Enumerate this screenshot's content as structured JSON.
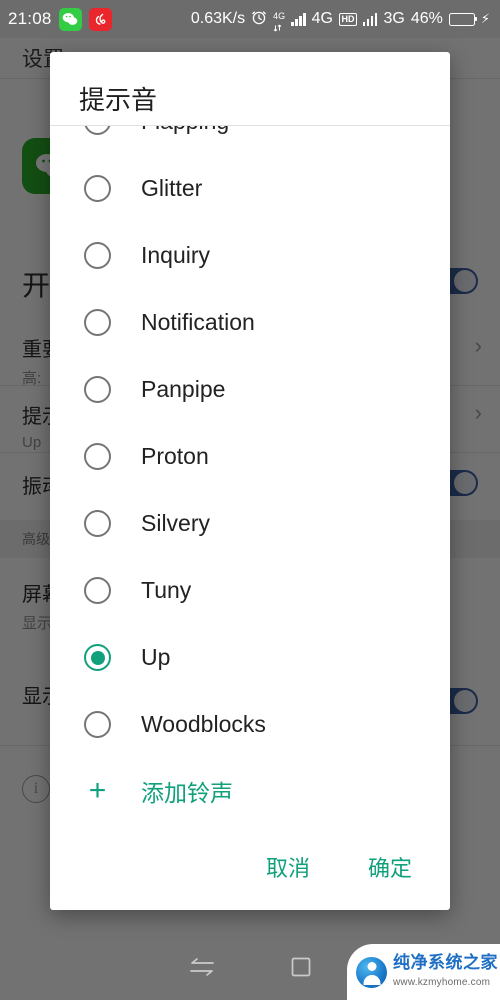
{
  "statusbar": {
    "time": "21:08",
    "apps": [
      {
        "name": "wechat-icon",
        "glyph": "💬"
      },
      {
        "name": "netease-music-icon",
        "glyph": "♫"
      }
    ],
    "network_speed": "0.63K/s",
    "alarm_icon": "⏰",
    "data_badge": "4G",
    "sim1_label": "4G",
    "hd_label": "HD",
    "sim2_label": "3G",
    "battery_percent": "46%",
    "charging": true
  },
  "background": {
    "screen_title": "设置",
    "app_name_row": "开",
    "rows": [
      {
        "label": "重要",
        "sub": "高:"
      },
      {
        "label": "提示音",
        "sub": "Up"
      },
      {
        "label": "振动",
        "sub": ""
      },
      {
        "label": "屏幕",
        "sub": "显示"
      },
      {
        "label": "显示",
        "sub": ""
      }
    ],
    "section_header": "高级",
    "toggle_color": "#3b5b9b",
    "chevron": "›"
  },
  "navbar": {
    "items": [
      {
        "name": "nav-back-icon"
      },
      {
        "name": "nav-recents-icon"
      }
    ]
  },
  "dialog": {
    "title": "提示音",
    "selected_value": "Up",
    "accent_color": "#10a07c",
    "options": [
      {
        "label": "Flapping",
        "selected": false
      },
      {
        "label": "Glitter",
        "selected": false
      },
      {
        "label": "Inquiry",
        "selected": false
      },
      {
        "label": "Notification",
        "selected": false
      },
      {
        "label": "Panpipe",
        "selected": false
      },
      {
        "label": "Proton",
        "selected": false
      },
      {
        "label": "Silvery",
        "selected": false
      },
      {
        "label": "Tuny",
        "selected": false
      },
      {
        "label": "Up",
        "selected": true
      },
      {
        "label": "Woodblocks",
        "selected": false
      }
    ],
    "add_ringtone": {
      "icon": "+",
      "label": "添加铃声"
    },
    "cancel_label": "取消",
    "confirm_label": "确定"
  },
  "watermark": {
    "name_cn": "纯净系统之家",
    "url": "www.kzmyhome.com"
  }
}
